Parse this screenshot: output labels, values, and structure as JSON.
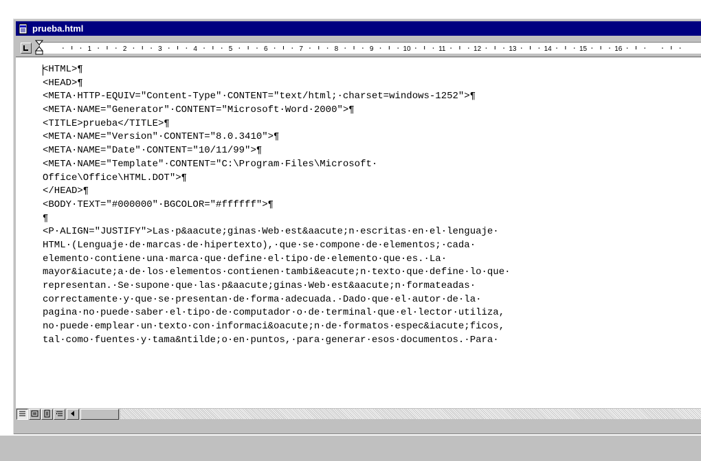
{
  "window": {
    "title": "prueba.html"
  },
  "ruler": {
    "numbers": [
      "1",
      "2",
      "3",
      "4",
      "5",
      "6",
      "7",
      "8",
      "9",
      "10",
      "11",
      "12",
      "13",
      "14",
      "15",
      "16"
    ]
  },
  "document": {
    "lines": [
      "<HTML>¶",
      "<HEAD>¶",
      "<META·HTTP-EQUIV=\"Content-Type\"·CONTENT=\"text/html;·charset=windows-1252\">¶",
      "<META·NAME=\"Generator\"·CONTENT=\"Microsoft·Word·2000\">¶",
      "<TITLE>prueba</TITLE>¶",
      "<META·NAME=\"Version\"·CONTENT=\"8.0.3410\">¶",
      "<META·NAME=\"Date\"·CONTENT=\"10/11/99\">¶",
      "<META·NAME=\"Template\"·CONTENT=\"C:\\Program·Files\\Microsoft·",
      "Office\\Office\\HTML.DOT\">¶",
      "</HEAD>¶",
      "<BODY·TEXT=\"#000000\"·BGCOLOR=\"#ffffff\">¶",
      "¶",
      "<P·ALIGN=\"JUSTIFY\">Las·p&aacute;ginas·Web·est&aacute;n·escritas·en·el·lenguaje·",
      "HTML·(Lenguaje·de·marcas·de·hipertexto),·que·se·compone·de·elementos;·cada·",
      "elemento·contiene·una·marca·que·define·el·tipo·de·elemento·que·es.·La·",
      "mayor&iacute;a·de·los·elementos·contienen·tambi&eacute;n·texto·que·define·lo·que·",
      "representan.·Se·supone·que·las·p&aacute;ginas·Web·est&aacute;n·formateadas·",
      "correctamente·y·que·se·presentan·de·forma·adecuada.·Dado·que·el·autor·de·la·",
      "pagina·no·puede·saber·el·tipo·de·computador·o·de·terminal·que·el·lector·utiliza,",
      "no·puede·emplear·un·texto·con·informaci&oacute;n·de·formatos·espec&iacute;ficos,",
      "tal·como·fuentes·y·tama&ntilde;o·en·puntos,·para·generar·esos·documentos.·Para·"
    ]
  },
  "colors": {
    "titlebar": "#000080",
    "chrome": "#c0c0c0"
  }
}
